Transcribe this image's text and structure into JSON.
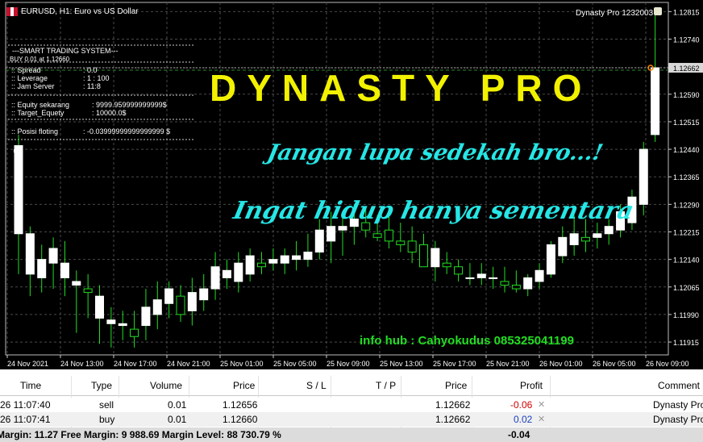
{
  "chart": {
    "symbol_title": "EURUSD, H1:  Euro vs US Dollar",
    "ea_name": "Dynasty Pro 1232003",
    "price_axis": [
      "1.12815",
      "1.12740",
      "1.12662",
      "1.12590",
      "1.12515",
      "1.12440",
      "1.12365",
      "1.12290",
      "1.12215",
      "1.12140",
      "1.12065",
      "1.11990",
      "1.11915"
    ],
    "current_price": "1.12662",
    "time_axis": [
      "24 Nov 2021",
      "24 Nov 13:00",
      "24 Nov 17:00",
      "24 Nov 21:00",
      "25 Nov 01:00",
      "25 Nov 05:00",
      "25 Nov 09:00",
      "25 Nov 13:00",
      "25 Nov 17:00",
      "25 Nov 21:00",
      "26 Nov 01:00",
      "26 Nov 05:00",
      "26 Nov 09:00"
    ],
    "colors": {
      "background": "#000000",
      "bull": "#ffffff",
      "bear": "#000000",
      "wick": "#22dd22",
      "grid": "#4a4a4a",
      "title": "#f2f200",
      "script": "#26e6e6",
      "info": "#22dd22"
    }
  },
  "panel": {
    "header": "---SMART TRADING SYSTEM---",
    "buy_line": "BUY 0.01 at 1.12660",
    "spread": ":: Spread",
    "spread_val": ": 0.0",
    "leverage": ":: Leverage",
    "leverage_val": ": 1 : 100",
    "server": ":: Jam Server",
    "server_val": ": 11:8",
    "equity": ":: Equity sekarang",
    "equity_val": ": 9999.959999999999$",
    "target": ":: Target_Equety",
    "target_val": ": 10000.0$",
    "floating": ":: Posisi floting",
    "floating_val": ": -0.03999999999999999 $"
  },
  "overlay": {
    "title": "DYNASTY PRO",
    "message1": "Jangan lupa sedekah bro...!",
    "message2": "Ingat hidup hanya sementara",
    "info_hub": "info hub : Cahyokudus 085325041199"
  },
  "table": {
    "headers": {
      "time": "Time",
      "type": "Type",
      "volume": "Volume",
      "price": "Price",
      "sl": "S / L",
      "tp": "T / P",
      "price2": "Price",
      "profit": "Profit",
      "comment": "Comment"
    },
    "rows": [
      {
        "time": "26 11:07:40",
        "type": "sell",
        "volume": "0.01",
        "price": "1.12656",
        "price2": "1.12662",
        "profit": "-0.06",
        "comment": "Dynasty Pro"
      },
      {
        "time": "26 11:07:41",
        "type": "buy",
        "volume": "0.01",
        "price": "1.12660",
        "price2": "1.12662",
        "profit": "0.02",
        "comment": "Dynasty Pro"
      }
    ],
    "status": "Margin: 11.27  Free Margin: 9 988.69  Margin Level: 88 730.79 %",
    "total_profit": "-0.04"
  },
  "chart_data": {
    "type": "candlestick",
    "ylim": [
      1.1188,
      1.1284
    ],
    "x": [
      "24 Nov 2021",
      "24 Nov 13:00",
      "24 Nov 17:00",
      "24 Nov 21:00",
      "25 Nov 01:00",
      "25 Nov 05:00",
      "25 Nov 09:00",
      "25 Nov 13:00",
      "25 Nov 17:00",
      "25 Nov 21:00",
      "26 Nov 01:00",
      "26 Nov 05:00",
      "26 Nov 09:00"
    ],
    "candles": [
      {
        "o": 1.1221,
        "h": 1.1248,
        "l": 1.121,
        "c": 1.1245
      },
      {
        "o": 1.121,
        "h": 1.1223,
        "l": 1.1204,
        "c": 1.1221
      },
      {
        "o": 1.1209,
        "h": 1.1218,
        "l": 1.1205,
        "c": 1.1214
      },
      {
        "o": 1.1213,
        "h": 1.122,
        "l": 1.1206,
        "c": 1.1217
      },
      {
        "o": 1.1209,
        "h": 1.1219,
        "l": 1.1204,
        "c": 1.1213
      },
      {
        "o": 1.1207,
        "h": 1.1211,
        "l": 1.1194,
        "c": 1.1208
      },
      {
        "o": 1.1206,
        "h": 1.121,
        "l": 1.1198,
        "c": 1.1205
      },
      {
        "o": 1.1198,
        "h": 1.1207,
        "l": 1.1191,
        "c": 1.1204
      },
      {
        "o": 1.11965,
        "h": 1.1201,
        "l": 1.119,
        "c": 1.11975
      },
      {
        "o": 1.1196,
        "h": 1.12,
        "l": 1.1192,
        "c": 1.11965
      },
      {
        "o": 1.1195,
        "h": 1.12,
        "l": 1.119,
        "c": 1.1193
      },
      {
        "o": 1.1196,
        "h": 1.1206,
        "l": 1.1192,
        "c": 1.1201
      },
      {
        "o": 1.1199,
        "h": 1.1208,
        "l": 1.1195,
        "c": 1.1203
      },
      {
        "o": 1.1202,
        "h": 1.1208,
        "l": 1.1198,
        "c": 1.1206
      },
      {
        "o": 1.1204,
        "h": 1.1207,
        "l": 1.1197,
        "c": 1.1199
      },
      {
        "o": 1.12,
        "h": 1.1209,
        "l": 1.1196,
        "c": 1.1205
      },
      {
        "o": 1.1203,
        "h": 1.121,
        "l": 1.12,
        "c": 1.1206
      },
      {
        "o": 1.1206,
        "h": 1.1216,
        "l": 1.1203,
        "c": 1.1212
      },
      {
        "o": 1.1209,
        "h": 1.1214,
        "l": 1.1206,
        "c": 1.1211
      },
      {
        "o": 1.1208,
        "h": 1.1216,
        "l": 1.1205,
        "c": 1.1213
      },
      {
        "o": 1.121,
        "h": 1.1217,
        "l": 1.1208,
        "c": 1.1215
      },
      {
        "o": 1.1213,
        "h": 1.1216,
        "l": 1.121,
        "c": 1.1212
      },
      {
        "o": 1.1213,
        "h": 1.1217,
        "l": 1.1211,
        "c": 1.1214
      },
      {
        "o": 1.1213,
        "h": 1.1217,
        "l": 1.121,
        "c": 1.1215
      },
      {
        "o": 1.1214,
        "h": 1.1219,
        "l": 1.1211,
        "c": 1.1215
      },
      {
        "o": 1.1214,
        "h": 1.1221,
        "l": 1.1212,
        "c": 1.1216
      },
      {
        "o": 1.1216,
        "h": 1.1225,
        "l": 1.1214,
        "c": 1.1222
      },
      {
        "o": 1.1219,
        "h": 1.1227,
        "l": 1.1213,
        "c": 1.1223
      },
      {
        "o": 1.1222,
        "h": 1.1226,
        "l": 1.1215,
        "c": 1.1223
      },
      {
        "o": 1.1223,
        "h": 1.1229,
        "l": 1.1218,
        "c": 1.1225
      },
      {
        "o": 1.1224,
        "h": 1.1228,
        "l": 1.122,
        "c": 1.1222
      },
      {
        "o": 1.1221,
        "h": 1.1226,
        "l": 1.1219,
        "c": 1.122
      },
      {
        "o": 1.1222,
        "h": 1.1226,
        "l": 1.1217,
        "c": 1.1219
      },
      {
        "o": 1.1219,
        "h": 1.1224,
        "l": 1.1216,
        "c": 1.1218
      },
      {
        "o": 1.1219,
        "h": 1.1223,
        "l": 1.1213,
        "c": 1.1216
      },
      {
        "o": 1.1218,
        "h": 1.1221,
        "l": 1.1213,
        "c": 1.1212
      },
      {
        "o": 1.1212,
        "h": 1.1219,
        "l": 1.1208,
        "c": 1.1217
      },
      {
        "o": 1.1213,
        "h": 1.1216,
        "l": 1.121,
        "c": 1.1212
      },
      {
        "o": 1.1212,
        "h": 1.1214,
        "l": 1.1208,
        "c": 1.121
      },
      {
        "o": 1.1209,
        "h": 1.1213,
        "l": 1.1207,
        "c": 1.1209
      },
      {
        "o": 1.1209,
        "h": 1.1213,
        "l": 1.1207,
        "c": 1.121
      },
      {
        "o": 1.1209,
        "h": 1.1212,
        "l": 1.1206,
        "c": 1.1209
      },
      {
        "o": 1.1208,
        "h": 1.1212,
        "l": 1.1205,
        "c": 1.1207
      },
      {
        "o": 1.1207,
        "h": 1.1211,
        "l": 1.1205,
        "c": 1.1206
      },
      {
        "o": 1.1206,
        "h": 1.121,
        "l": 1.1204,
        "c": 1.1209
      },
      {
        "o": 1.1208,
        "h": 1.1213,
        "l": 1.1206,
        "c": 1.1211
      },
      {
        "o": 1.121,
        "h": 1.1219,
        "l": 1.1209,
        "c": 1.1218
      },
      {
        "o": 1.1215,
        "h": 1.1223,
        "l": 1.1213,
        "c": 1.122
      },
      {
        "o": 1.1218,
        "h": 1.1226,
        "l": 1.1215,
        "c": 1.1221
      },
      {
        "o": 1.122,
        "h": 1.1225,
        "l": 1.1216,
        "c": 1.1219
      },
      {
        "o": 1.122,
        "h": 1.1224,
        "l": 1.1217,
        "c": 1.1221
      },
      {
        "o": 1.1221,
        "h": 1.1225,
        "l": 1.1218,
        "c": 1.1223
      },
      {
        "o": 1.1222,
        "h": 1.1229,
        "l": 1.122,
        "c": 1.1227
      },
      {
        "o": 1.1224,
        "h": 1.1233,
        "l": 1.1222,
        "c": 1.1231
      },
      {
        "o": 1.1229,
        "h": 1.1246,
        "l": 1.1226,
        "c": 1.1244
      },
      {
        "o": 1.1248,
        "h": 1.1281,
        "l": 1.1246,
        "c": 1.12662
      }
    ]
  }
}
